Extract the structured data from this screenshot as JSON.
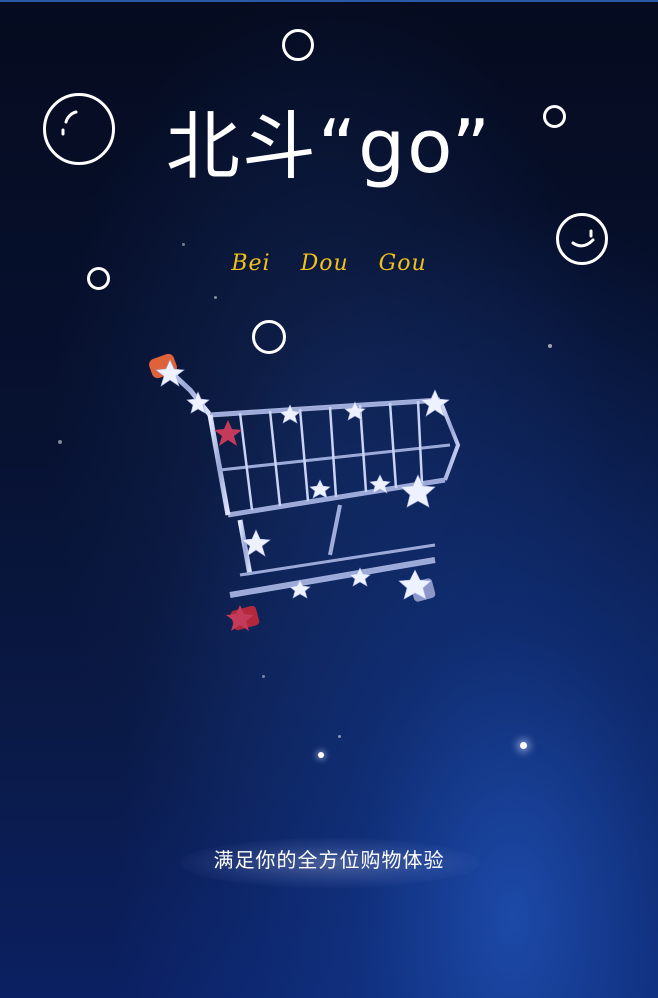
{
  "poster": {
    "title": "北斗“go”",
    "subtitle": "Bei Dou Gou",
    "tagline": "满足你的全方位购物体验"
  },
  "colors": {
    "background_top": "#050b1f",
    "background_bottom": "#0b2062",
    "subtitle": "#f2c21a",
    "text": "#ffffff"
  },
  "icons": {
    "cart": "shopping-cart-icon",
    "smiley_bubble": "smiley-bubble-icon"
  }
}
